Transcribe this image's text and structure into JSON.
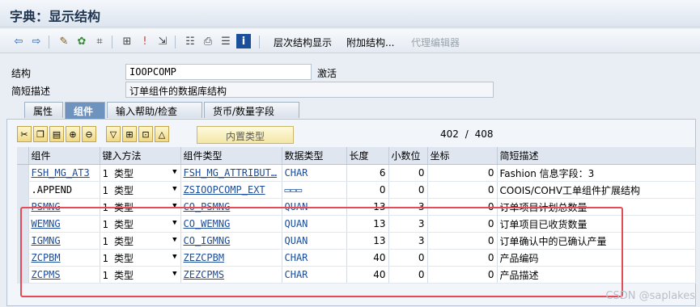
{
  "window": {
    "title": "字典：显示结构"
  },
  "toolbar": {
    "icons": [
      "back-icon",
      "forward-icon",
      "check-icon",
      "activate-icon",
      "where-used-icon",
      "hierarchy-icon",
      "info-icon",
      "display-object-icon",
      "table-icon",
      "print-icon",
      "list-icon",
      "help-icon"
    ],
    "hierarchy_label": "层次结构显示",
    "append_label": "附加结构...",
    "proxy_label": "代理编辑器"
  },
  "structure": {
    "label": "结构",
    "value": "IOOPCOMP",
    "status": "激活"
  },
  "description": {
    "label": "简短描述",
    "value": "订单组件的数据库结构"
  },
  "tabs": [
    "属性",
    "组件",
    "输入帮助/检查",
    "货币/数量字段"
  ],
  "grid_toolbar": {
    "builtin_label": "内置类型",
    "counter_current": "402",
    "counter_sep": "/",
    "counter_total": "408"
  },
  "columns": [
    "组件",
    "键入方法",
    "组件类型",
    "数据类型",
    "长度",
    "小数位",
    "坐标",
    "简短描述"
  ],
  "rows": [
    {
      "component": "FSH_MG_AT3",
      "method": "1 类型",
      "ctype": "FSH_MG_ATTRIBUT…",
      "dtype": "CHAR",
      "length": "6",
      "decimals": "0",
      "coord": "0",
      "desc": "Fashion 信息字段：3"
    },
    {
      "component": ".APPEND",
      "method": "1 类型",
      "ctype": "ZSIOOPCOMP_EXT",
      "dtype": "▭▭▭",
      "length": "0",
      "decimals": "0",
      "coord": "0",
      "desc": "COOIS/COHV工单组件扩展结构"
    },
    {
      "component": "PSMNG",
      "method": "1 类型",
      "ctype": "CO_PSMNG",
      "dtype": "QUAN",
      "length": "13",
      "decimals": "3",
      "coord": "0",
      "desc": "订单项目计划总数量"
    },
    {
      "component": "WEMNG",
      "method": "1 类型",
      "ctype": "CO_WEMNG",
      "dtype": "QUAN",
      "length": "13",
      "decimals": "3",
      "coord": "0",
      "desc": "订单项目已收货数量"
    },
    {
      "component": "IGMNG",
      "method": "1 类型",
      "ctype": "CO_IGMNG",
      "dtype": "QUAN",
      "length": "13",
      "decimals": "3",
      "coord": "0",
      "desc": "订单确认中的已确认产量"
    },
    {
      "component": "ZCPBM",
      "method": "1 类型",
      "ctype": "ZEZCPBM",
      "dtype": "CHAR",
      "length": "40",
      "decimals": "0",
      "coord": "0",
      "desc": "产品编码"
    },
    {
      "component": "ZCPMS",
      "method": "1 类型",
      "ctype": "ZEZCPMS",
      "dtype": "CHAR",
      "length": "40",
      "decimals": "0",
      "coord": "0",
      "desc": "产品描述"
    }
  ],
  "watermark": "CSDN @saplakes",
  "colors": {
    "active_tab": "#6f93bf",
    "highlight": "#e54a57",
    "link": "#1b4d9a"
  }
}
